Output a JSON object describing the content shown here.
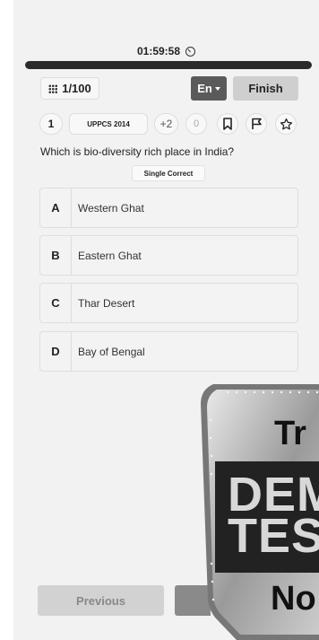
{
  "timer": {
    "text": "01:59:58",
    "icon": "timer-icon"
  },
  "progress": {
    "fraction": 1.0
  },
  "header": {
    "counter": "1/100",
    "language": "En",
    "finish_label": "Finish"
  },
  "meta": {
    "question_number": "1",
    "exam_tag": "UPPCS 2014",
    "positive_marks": "+2",
    "negative_marks": "0",
    "icons": [
      "bookmark-icon",
      "flag-icon",
      "star-icon"
    ]
  },
  "question": {
    "text": "Which is bio-diversity rich place in India?",
    "type": "Single Correct"
  },
  "options": [
    {
      "letter": "A",
      "text": "Western Ghat"
    },
    {
      "letter": "B",
      "text": "Eastern Ghat"
    },
    {
      "letter": "C",
      "text": "Thar Desert"
    },
    {
      "letter": "D",
      "text": "Bay of Bengal"
    }
  ],
  "footer": {
    "previous_label": "Previous"
  },
  "demo_overlay": {
    "line_top": "Tr",
    "line_mid1": "DEM",
    "line_mid2": "TES",
    "line_bottom": "No"
  }
}
